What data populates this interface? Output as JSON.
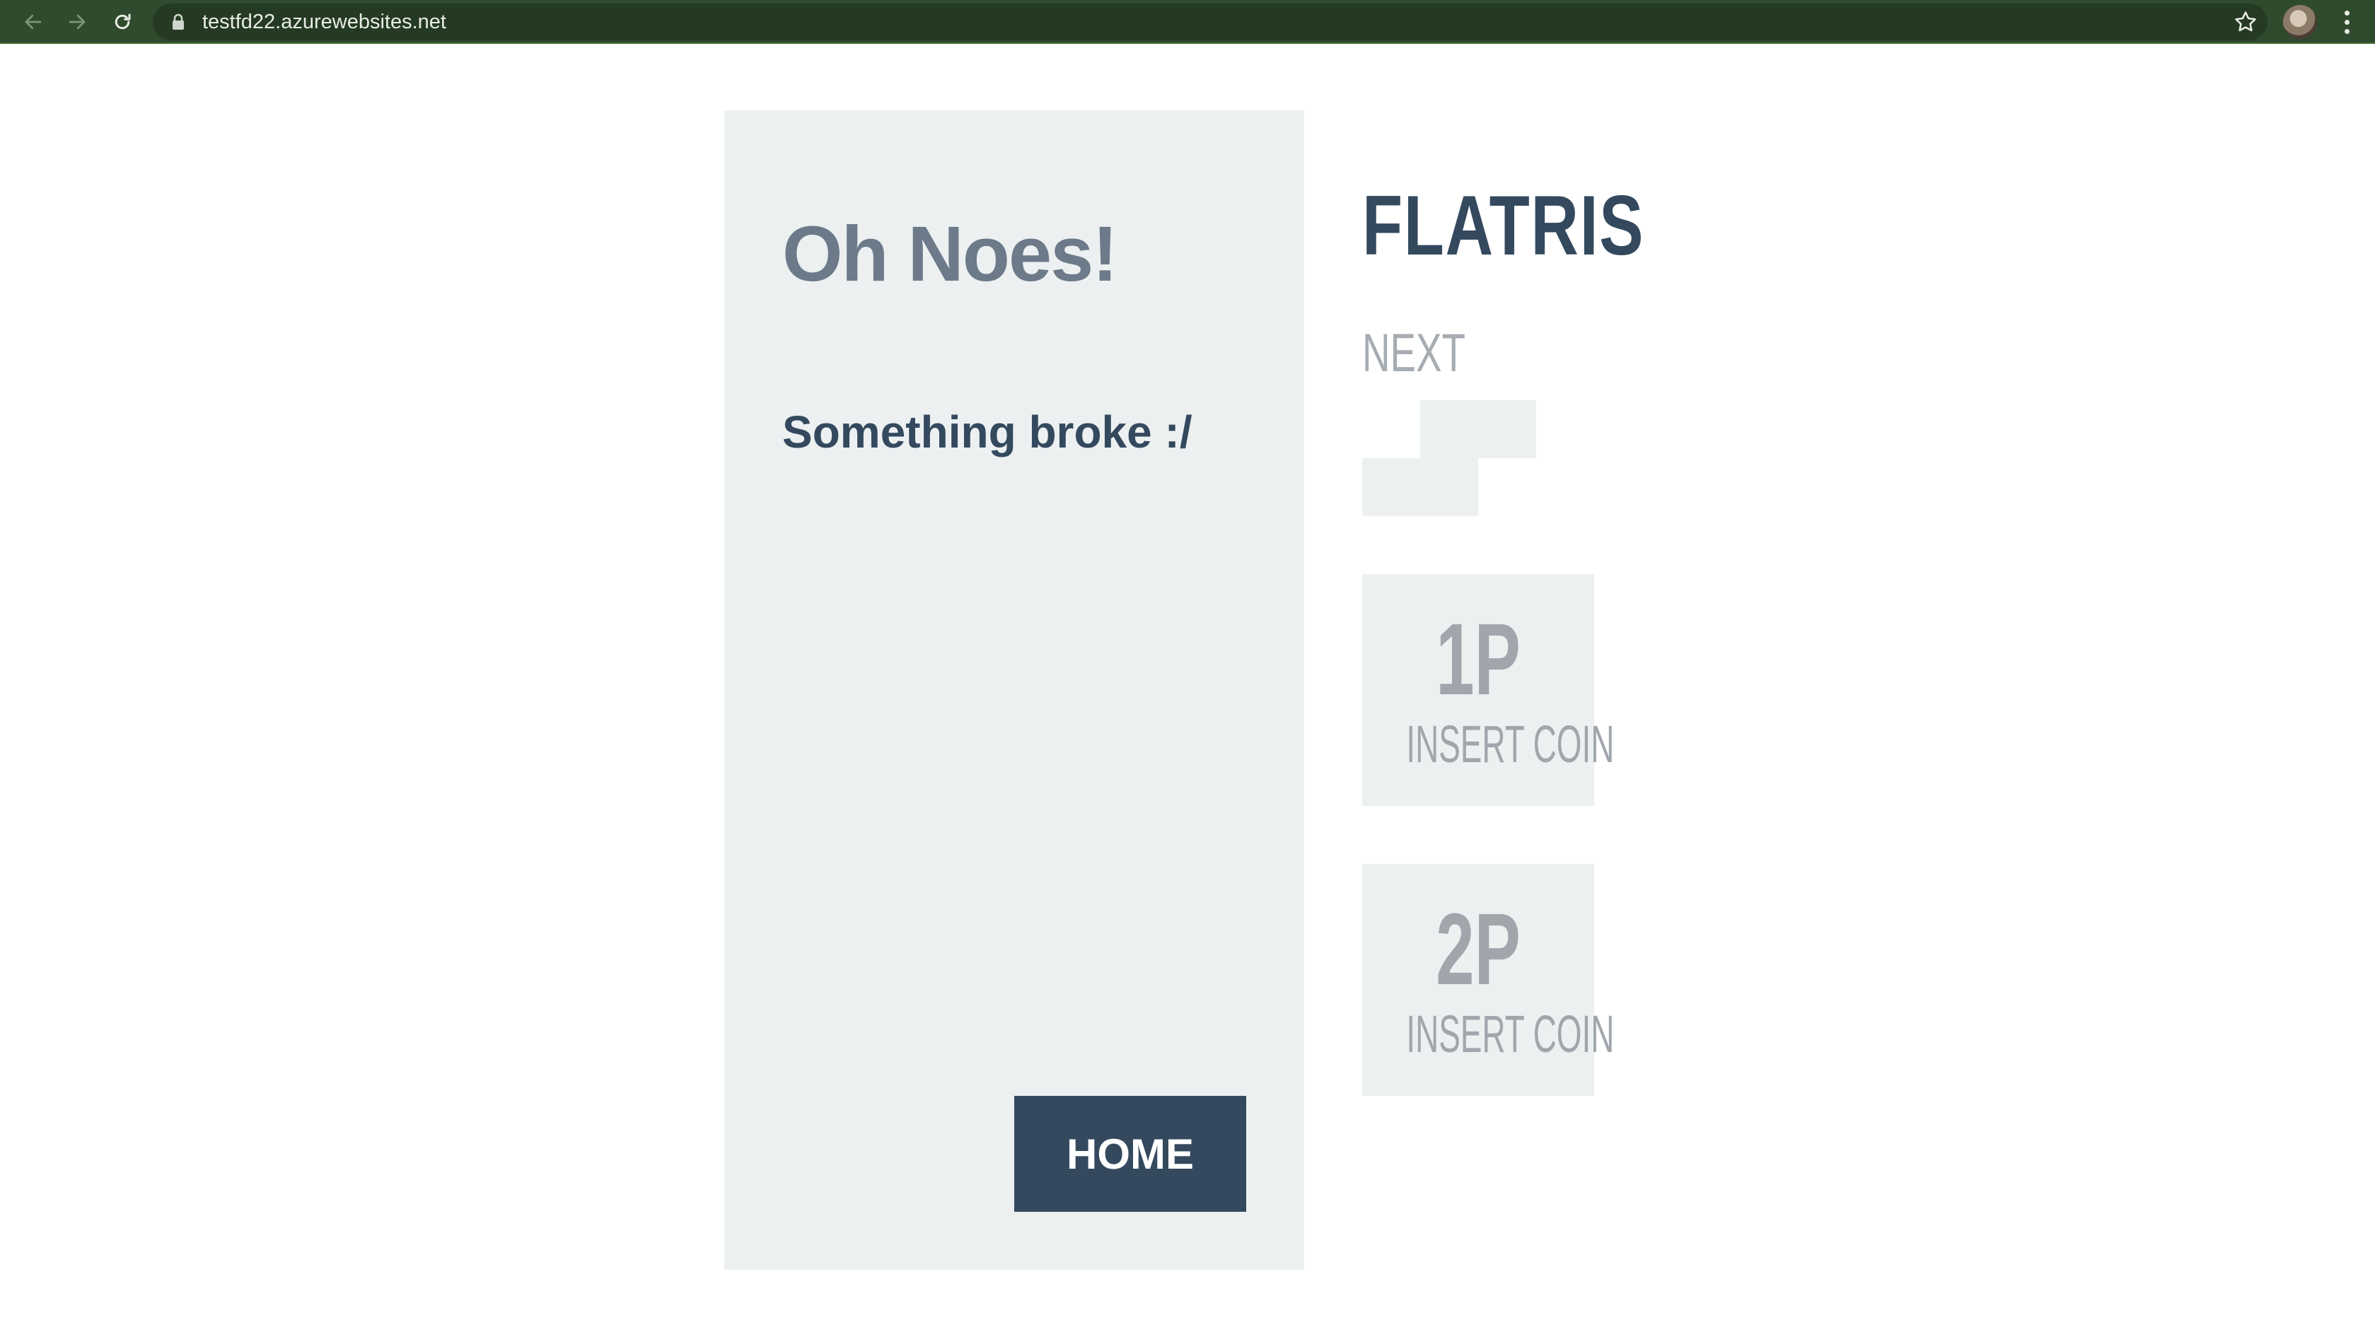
{
  "browser": {
    "url": "testfd22.azurewebsites.net",
    "icons": [
      "back-arrow-icon",
      "forward-arrow-icon",
      "reload-icon",
      "lock-icon",
      "star-icon",
      "profile-avatar",
      "kebab-menu-icon"
    ]
  },
  "error": {
    "heading": "Oh Noes!",
    "message": "Something broke :/",
    "home_label": "HOME"
  },
  "sidebar": {
    "title": "FLATRIS",
    "next_label": "NEXT",
    "players": [
      {
        "id": "1P",
        "status": "INSERT COIN"
      },
      {
        "id": "2P",
        "status": "INSERT COIN"
      }
    ]
  },
  "colors": {
    "chrome": "#2f4a2c",
    "well": "#ecf0f1",
    "primary": "#34495e",
    "muted": "#a0a6ab"
  }
}
